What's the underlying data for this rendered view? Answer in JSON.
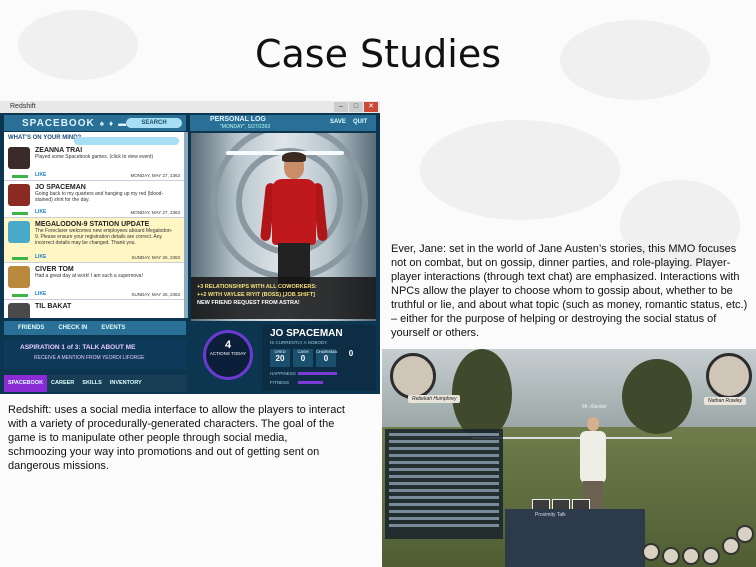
{
  "slide": {
    "title": "Case Studies",
    "redshift_caption": "Redshift: uses a social media interface to allow the players to interact with a variety of procedurally-generated characters. The goal of the game is to manipulate other people through social media, schmoozing your way into promotions  and out of getting sent on dangerous missions.",
    "everjane_caption": "Ever, Jane: set in the world of Jane Austen’s stories, this MMO focuses not on combat, but on gossip, dinner parties, and role-playing. Player-player interactions (through text chat) are emphasized. Interactions with NPCs allow the player to choose whom to gossip about, whether to be truthful or lie, and about what topic (such as money, romantic status, etc.) – either for the purpose of helping or destroying the social status of yourself or others."
  },
  "redshift": {
    "window_title": "Redshift",
    "spacebook": {
      "logo": "SPACEBOOK",
      "search_label": "SEARCH",
      "prompt": "WHAT'S ON YOUR MIND?",
      "posts": [
        {
          "name": "ZEANNA TRAI",
          "text": "Played some Spacebook games. (click to view event)",
          "like": "LIKE",
          "date": "MONDAY, MAY 27, 2363",
          "avatar_color": "#3a2a28"
        },
        {
          "name": "JO SPACEMAN",
          "text": "Going back to my quarters and hanging up my red (blood-stained) shirt for the day.",
          "like": "LIKE",
          "date": "MONDAY, MAY 27, 2363",
          "avatar_color": "#8b2a22"
        },
        {
          "name": "MEGALODON-9 STATION UPDATE",
          "text": "The Foreclarer welcomes new employees aboard Megalodon-9. Please ensure your registration details are correct. Any incorrect details may be changed. Thank you.",
          "like": "LIKE",
          "date": "SUNDAY, MAY 26, 2363",
          "avatar_color": "#4aa9c9"
        },
        {
          "name": "CIVER TOM",
          "text": "Had a great day at work! I am such a supernova!",
          "like": "LIKE",
          "date": "SUNDAY, MAY 26, 2363",
          "avatar_color": "#b98a3c"
        },
        {
          "name": "TIL BAKAT",
          "text": "",
          "like": "",
          "date": "",
          "avatar_color": "#4a4a4a"
        }
      ],
      "nav": [
        "FRIENDS",
        "CHECK IN",
        "EVENTS"
      ]
    },
    "log": {
      "title": "PERSONAL LOG",
      "date": "\"MONDAY\", 5/27/2363",
      "save": "SAVE",
      "quit": "QUIT",
      "messages": [
        {
          "text": "+3 RELATIONSHIPS WITH ALL COWORKERS:",
          "color": "#f4e07a"
        },
        {
          "text": "++2 WITH VAYLEE RIYIT (BOSS) [JOB SHIFT]",
          "color": "#f4e07a"
        },
        {
          "text": "NEW FRIEND REQUEST FROM ASTRA!",
          "color": "#ffffff"
        }
      ]
    },
    "aspiration": {
      "title": "ASPIRATION 1 of 3: TALK ABOUT ME",
      "subtitle": "RECEIVE A MENTION FROM YEORDI LIFORGE"
    },
    "tabs": [
      "SPACEBOOK",
      "CAREER",
      "SKILLS",
      "INVENTORY"
    ],
    "actions": {
      "count": "4",
      "label": "ACTIONS TODAY"
    },
    "profile": {
      "name": "JO SPACEMAN",
      "subtitle": "IS CURRENTLY A NOBODY.",
      "stats": [
        {
          "key": "CRED",
          "value": "20"
        },
        {
          "key": "CASH",
          "value": "0"
        },
        {
          "key": "CHARISMA",
          "value": "0"
        },
        {
          "key": "",
          "value": "0"
        }
      ],
      "meters": [
        {
          "label": "HAPPINESS",
          "level": 0.55
        },
        {
          "label": "FITNESS",
          "level": 0.35
        }
      ]
    }
  },
  "everjane": {
    "left_name": "Rebekah Humphrey",
    "right_name": "Nathan Rowley",
    "player_label": "Mr. Alastair",
    "panel_label": "Proximity Talk"
  }
}
